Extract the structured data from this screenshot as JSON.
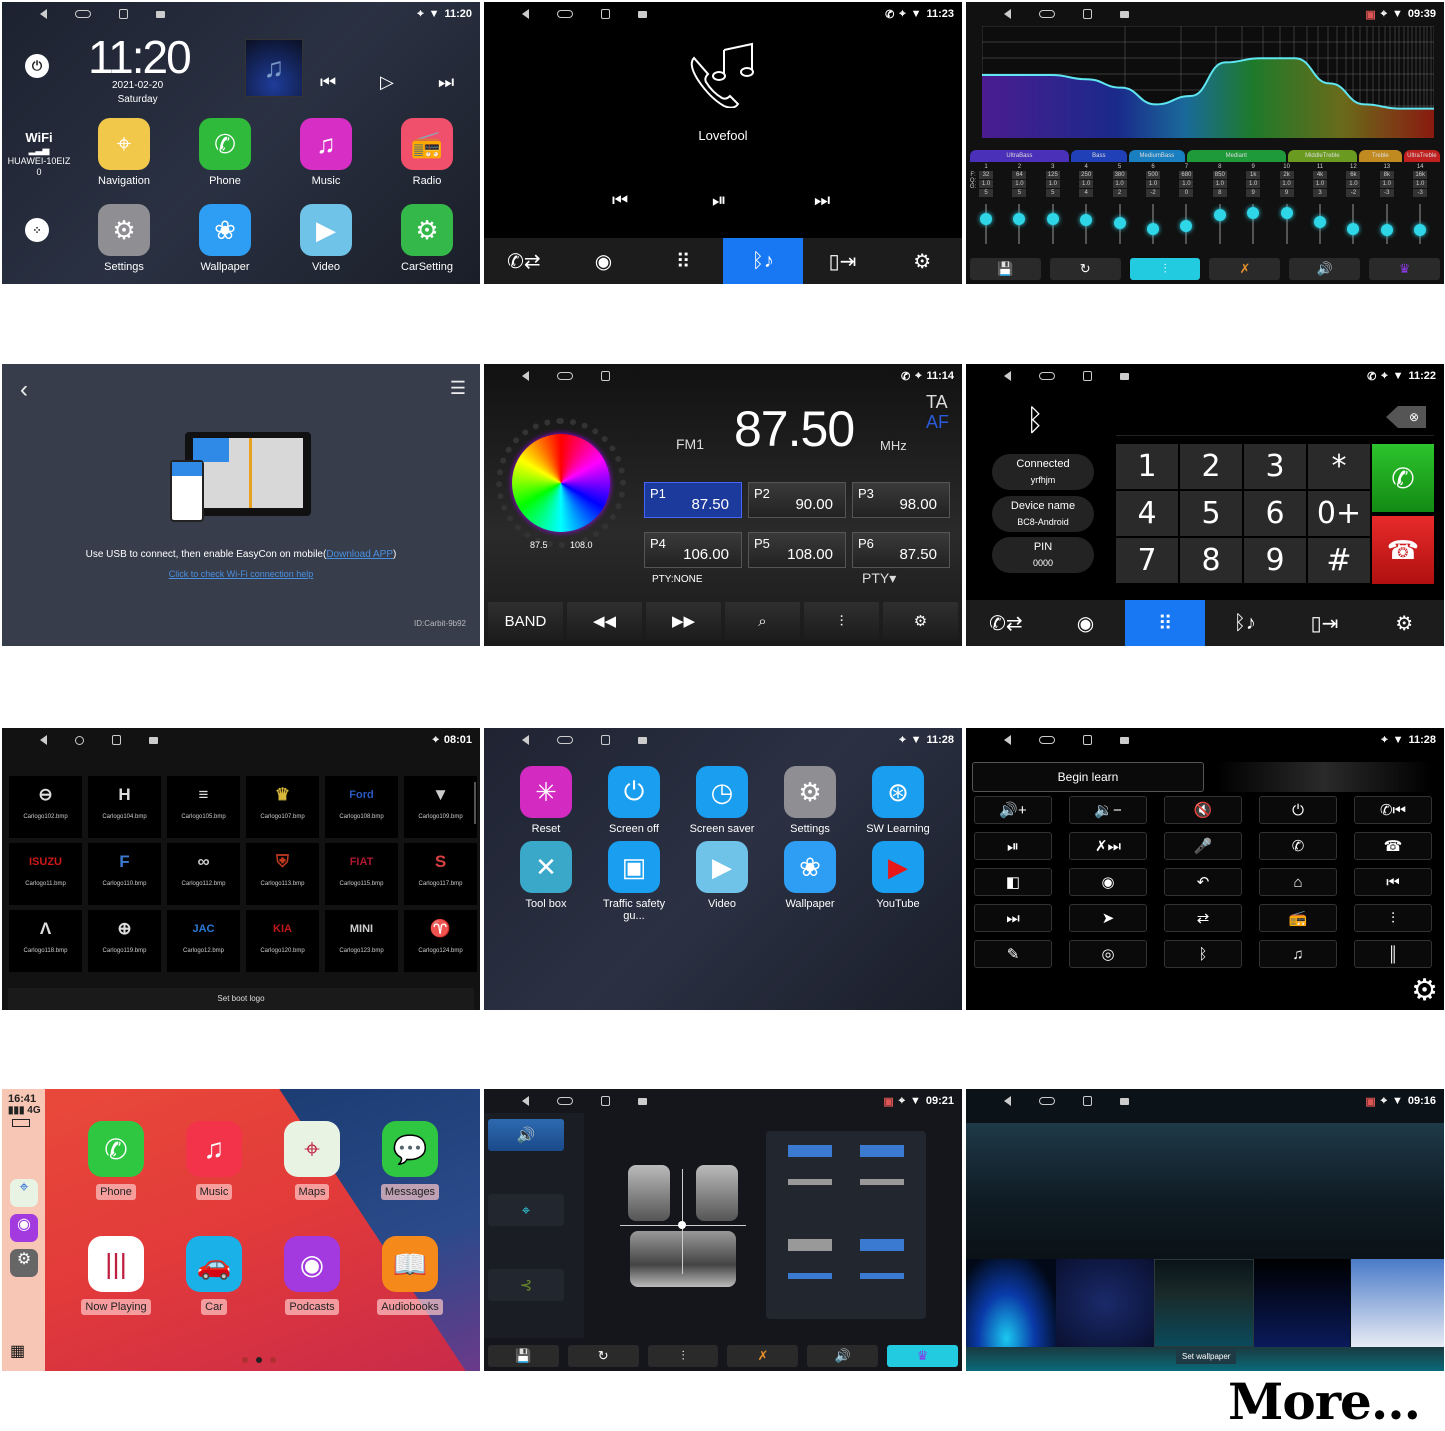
{
  "home": {
    "status_time": "11:20",
    "clock": "11:20",
    "date": "2021-02-20",
    "day": "Saturday",
    "wifi_label": "WiFi",
    "wifi_ssid": "HUAWEI-10EIZ0",
    "apps": [
      {
        "label": "Navigation",
        "icon": "map-icon",
        "color": "#f2c84b"
      },
      {
        "label": "Phone",
        "icon": "phone-icon",
        "color": "#2fba3c"
      },
      {
        "label": "Music",
        "icon": "music-icon",
        "color": "#d72ec5"
      },
      {
        "label": "Radio",
        "icon": "radio-icon",
        "color": "#f0506b"
      },
      {
        "label": "Settings",
        "icon": "gear-icon",
        "color": "#8e8e93"
      },
      {
        "label": "Wallpaper",
        "icon": "flower-icon",
        "color": "#2e9ef5"
      },
      {
        "label": "Video",
        "icon": "clapper-icon",
        "color": "#6fc3e8"
      },
      {
        "label": "CarSetting",
        "icon": "car-settings-icon",
        "color": "#35b84a"
      }
    ]
  },
  "bt_music": {
    "status_time": "11:23",
    "track_title": "Lovefool",
    "tabs": [
      "call-log",
      "contacts",
      "dialpad",
      "bt-music",
      "phone-transfer",
      "settings"
    ],
    "active_tab": 3,
    "accent": "#1877f2"
  },
  "equalizer": {
    "status_time": "09:39",
    "bands": [
      {
        "name": "UltraBass",
        "color": "#4a2fb8"
      },
      {
        "name": "Bass",
        "color": "#2040b8"
      },
      {
        "name": "MediumBass",
        "color": "#1a7fc0"
      },
      {
        "name": "Mediant",
        "color": "#1e9a3a"
      },
      {
        "name": "MiddleTreble",
        "color": "#6a9a20"
      },
      {
        "name": "Treble",
        "color": "#c08a20"
      },
      {
        "name": "UltraTreble",
        "color": "#c02020"
      }
    ],
    "row_labels": [
      "F:",
      "Q:",
      "G:"
    ],
    "channels": [
      {
        "n": "1",
        "f": "32",
        "q": "1.0",
        "g": "5"
      },
      {
        "n": "2",
        "f": "64",
        "q": "1.0",
        "g": "5"
      },
      {
        "n": "3",
        "f": "125",
        "q": "1.0",
        "g": "5"
      },
      {
        "n": "4",
        "f": "250",
        "q": "1.0",
        "g": "4"
      },
      {
        "n": "5",
        "f": "380",
        "q": "1.0",
        "g": "2"
      },
      {
        "n": "6",
        "f": "500",
        "q": "1.0",
        "g": "-2"
      },
      {
        "n": "7",
        "f": "680",
        "q": "1.0",
        "g": "0"
      },
      {
        "n": "8",
        "f": "850",
        "q": "1.0",
        "g": "8"
      },
      {
        "n": "9",
        "f": "1k",
        "q": "1.0",
        "g": "9"
      },
      {
        "n": "10",
        "f": "2k",
        "q": "1.0",
        "g": "9"
      },
      {
        "n": "11",
        "f": "4k",
        "q": "1.0",
        "g": "3"
      },
      {
        "n": "12",
        "f": "6k",
        "q": "1.0",
        "g": "-2"
      },
      {
        "n": "13",
        "f": "8k",
        "q": "1.0",
        "g": "-3"
      },
      {
        "n": "14",
        "f": "16k",
        "q": "1.0",
        "g": "-3"
      }
    ],
    "tools": [
      "save-icon",
      "reset-icon",
      "eq-icon",
      "mute-icon",
      "speaker-icon",
      "crown-icon"
    ],
    "active_tool": 2
  },
  "easycon": {
    "message": "Use USB to connect, then enable EasyCon on mobile(",
    "download_link": "Download APP",
    "message_end": ")",
    "wifi_help": "Click to check Wi-Fi connection help",
    "device_id": "ID:Carbit-9b92"
  },
  "radio": {
    "status_time": "11:14",
    "band": "FM1",
    "frequency": "87.50",
    "unit": "MHz",
    "ta": "TA",
    "af": "AF",
    "dial_min": "87.5",
    "dial_max": "108.0",
    "presets": [
      {
        "name": "P1",
        "freq": "87.50",
        "active": true
      },
      {
        "name": "P2",
        "freq": "90.00"
      },
      {
        "name": "P3",
        "freq": "98.00"
      },
      {
        "name": "P4",
        "freq": "106.00"
      },
      {
        "name": "P5",
        "freq": "108.00"
      },
      {
        "name": "P6",
        "freq": "87.50"
      }
    ],
    "pty_status": "PTY:NONE",
    "pty_button": "PTY",
    "band_button": "BAND"
  },
  "dialer": {
    "status_time": "11:22",
    "connected_label": "Connected",
    "connected_device": "yrfhjm",
    "device_name_label": "Device name",
    "device_name": "BC8-Android",
    "pin_label": "PIN",
    "pin": "0000",
    "keys": [
      "1",
      "2",
      "3",
      "*",
      "4",
      "5",
      "6",
      "0+",
      "7",
      "8",
      "9",
      "#"
    ],
    "call_color": "#22a22a",
    "hangup_color": "#d81c1c",
    "active_tab": 2
  },
  "boot_logo": {
    "status_time": "08:01",
    "logos": [
      {
        "file": "Carlogo102.bmp",
        "glyph": "⊖",
        "color": "#ddd"
      },
      {
        "file": "Carlogo104.bmp",
        "glyph": "H",
        "color": "#ddd"
      },
      {
        "file": "Carlogo105.bmp",
        "glyph": "≡",
        "color": "#ddd"
      },
      {
        "file": "Carlogo107.bmp",
        "glyph": "♛",
        "color": "#d9b83a"
      },
      {
        "file": "Carlogo108.bmp",
        "glyph": "Ford",
        "color": "#2a5ac0"
      },
      {
        "file": "Carlogo109.bmp",
        "glyph": "▼",
        "color": "#ccc"
      },
      {
        "file": "Carlogo11.bmp",
        "glyph": "ISUZU",
        "color": "#d01818"
      },
      {
        "file": "Carlogo110.bmp",
        "glyph": "F",
        "color": "#3a7ad0"
      },
      {
        "file": "Carlogo112.bmp",
        "glyph": "∞",
        "color": "#ccc"
      },
      {
        "file": "Carlogo113.bmp",
        "glyph": "⛨",
        "color": "#c03a20"
      },
      {
        "file": "Carlogo115.bmp",
        "glyph": "FIAT",
        "color": "#b01830"
      },
      {
        "file": "Carlogo117.bmp",
        "glyph": "S",
        "color": "#d84040"
      },
      {
        "file": "Carlogo118.bmp",
        "glyph": "Λ",
        "color": "#ddd"
      },
      {
        "file": "Carlogo119.bmp",
        "glyph": "⊕",
        "color": "#ddd"
      },
      {
        "file": "Carlogo12.bmp",
        "glyph": "JAC",
        "color": "#2a7ad8"
      },
      {
        "file": "Carlogo120.bmp",
        "glyph": "KIA",
        "color": "#c01818"
      },
      {
        "file": "Carlogo123.bmp",
        "glyph": "MINI",
        "color": "#ccc"
      },
      {
        "file": "Carlogo124.bmp",
        "glyph": "♈",
        "color": "#c02040"
      }
    ],
    "footer": "Set boot logo"
  },
  "settings_apps": {
    "status_time": "11:28",
    "apps": [
      {
        "label": "Reset",
        "icon": "reset-icon",
        "color": "#d32bc2",
        "glyph": "✳"
      },
      {
        "label": "Screen off",
        "icon": "power-icon",
        "color": "#1a9ef0",
        "glyph": "⏻"
      },
      {
        "label": "Screen saver",
        "icon": "clock-icon",
        "color": "#1a9ef0",
        "glyph": "◷"
      },
      {
        "label": "Settings",
        "icon": "gear-icon",
        "color": "#8e8e93",
        "glyph": "⚙"
      },
      {
        "label": "SW Learning",
        "icon": "steering-wheel-icon",
        "color": "#1a9ef0",
        "glyph": "⊛"
      },
      {
        "label": "Tool box",
        "icon": "tools-icon",
        "color": "#3aa8c8",
        "glyph": "✕"
      },
      {
        "label": "Traffic safety gu...",
        "icon": "dashcam-icon",
        "color": "#1a9ef0",
        "glyph": "▣"
      },
      {
        "label": "Video",
        "icon": "clapper-icon",
        "color": "#6fc3e8",
        "glyph": "▶"
      },
      {
        "label": "Wallpaper",
        "icon": "flower-icon",
        "color": "#2e9ef5",
        "glyph": "❀"
      },
      {
        "label": "YouTube",
        "icon": "youtube-icon",
        "color": "#1a9ef0",
        "glyph": "▶"
      }
    ]
  },
  "sw_learning": {
    "status_time": "11:28",
    "begin_label": "Begin learn",
    "keys": [
      {
        "icon": "volume-up-icon",
        "glyph": "🔊+"
      },
      {
        "icon": "volume-down-icon",
        "glyph": "🔉−"
      },
      {
        "icon": "mute-icon",
        "glyph": "🔇"
      },
      {
        "icon": "power-icon",
        "glyph": "⏻"
      },
      {
        "icon": "call-prev-icon",
        "glyph": "✆⏮"
      },
      {
        "icon": "play-pause-icon",
        "glyph": "⏯"
      },
      {
        "icon": "hangup-next-icon",
        "glyph": "✗⏭"
      },
      {
        "icon": "mic-icon",
        "glyph": "🎤"
      },
      {
        "icon": "call-icon",
        "glyph": "✆"
      },
      {
        "icon": "hangup-icon",
        "glyph": "☎"
      },
      {
        "icon": "rear-camera-icon",
        "glyph": "◧"
      },
      {
        "icon": "360-camera-icon",
        "glyph": "◉"
      },
      {
        "icon": "back-icon",
        "glyph": "↶"
      },
      {
        "icon": "home-icon",
        "glyph": "⌂"
      },
      {
        "icon": "previous-icon",
        "glyph": "⏮"
      },
      {
        "icon": "next-icon",
        "glyph": "⏭"
      },
      {
        "icon": "navigation-icon",
        "glyph": "➤"
      },
      {
        "icon": "mode-icon",
        "glyph": "⇄"
      },
      {
        "icon": "radio-icon",
        "glyph": "📻"
      },
      {
        "icon": "equalizer-icon",
        "glyph": "⫶"
      },
      {
        "icon": "voice-icon",
        "glyph": "✎"
      },
      {
        "icon": "dvr-icon",
        "glyph": "◎"
      },
      {
        "icon": "bluetooth-icon",
        "glyph": "ᛒ"
      },
      {
        "icon": "music-icon",
        "glyph": "♫"
      },
      {
        "icon": "audio-wave-icon",
        "glyph": "║"
      }
    ]
  },
  "carplay": {
    "time": "16:41",
    "network": "4G",
    "apps": [
      {
        "label": "Phone",
        "color": "#2fc742",
        "glyph": "✆"
      },
      {
        "label": "Music",
        "color": "#f2334a",
        "glyph": "♫"
      },
      {
        "label": "Maps",
        "color": "#e9f3e4",
        "glyph": "⌖"
      },
      {
        "label": "Messages",
        "color": "#2fc742",
        "glyph": "💬"
      },
      {
        "label": "Now Playing",
        "color": "#ffffff",
        "glyph": "|||"
      },
      {
        "label": "Car",
        "color": "#1ab0e8",
        "glyph": "🚗"
      },
      {
        "label": "Podcasts",
        "color": "#a33ae0",
        "glyph": "◉"
      },
      {
        "label": "Audiobooks",
        "color": "#f58a1a",
        "glyph": "📖"
      }
    ],
    "page": 2,
    "page_count": 3
  },
  "fader": {
    "status_time": "09:21",
    "tools": [
      "save-icon",
      "reset-icon",
      "eq-icon",
      "mute-icon",
      "speaker-icon",
      "crown-icon"
    ],
    "active_tool": 5
  },
  "wallpaper": {
    "status_time": "09:16",
    "button": "Set wallpaper"
  },
  "more_label": "More..."
}
